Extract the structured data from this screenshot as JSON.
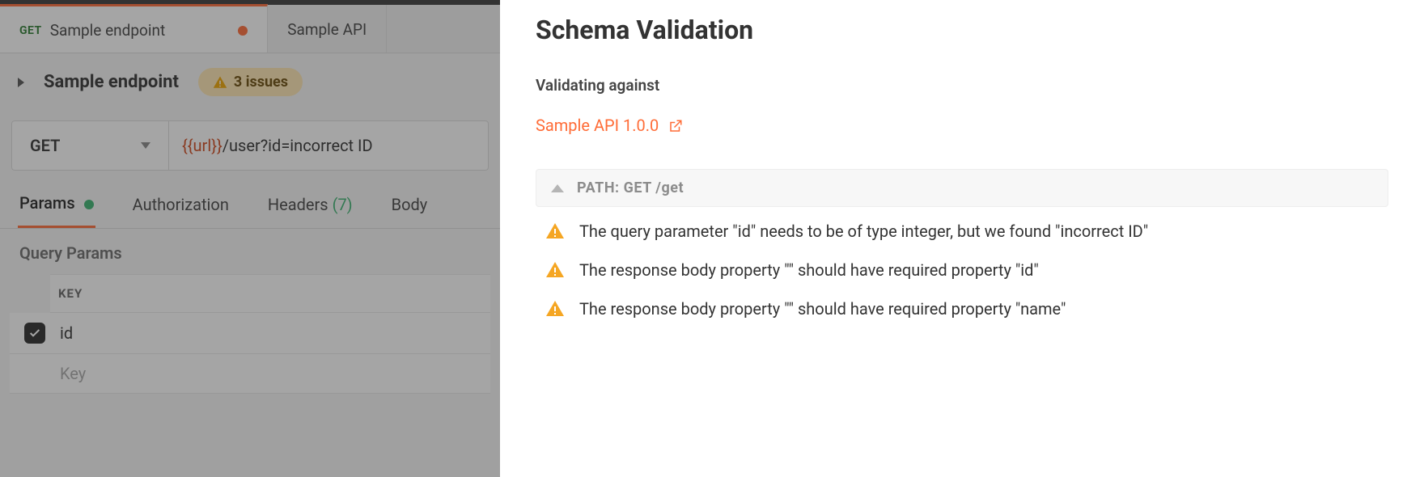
{
  "tabs": [
    {
      "method": "GET",
      "label": "Sample endpoint",
      "dirty": true,
      "active": true
    },
    {
      "label": "Sample API",
      "active": false
    }
  ],
  "request": {
    "name": "Sample endpoint",
    "issues_badge": "3 issues",
    "method": "GET",
    "url_var": "{{url}}",
    "url_rest": "/user?id=incorrect ID"
  },
  "subtabs": {
    "params": "Params",
    "authorization": "Authorization",
    "headers": "Headers",
    "headers_count": "(7)",
    "body": "Body"
  },
  "query_params": {
    "title": "Query Params",
    "key_header": "KEY",
    "rows": [
      {
        "key": "id",
        "checked": true
      }
    ],
    "placeholder_key": "Key"
  },
  "panel": {
    "title": "Schema Validation",
    "validating_label": "Validating against",
    "api_link": "Sample API 1.0.0",
    "path_header": "PATH: GET /get",
    "issues": [
      "The query parameter \"id\" needs to be of type integer, but we found \"incorrect ID\"",
      "The response body property \"\" should have required property \"id\"",
      "The response body property \"\" should have required property \"name\""
    ]
  }
}
